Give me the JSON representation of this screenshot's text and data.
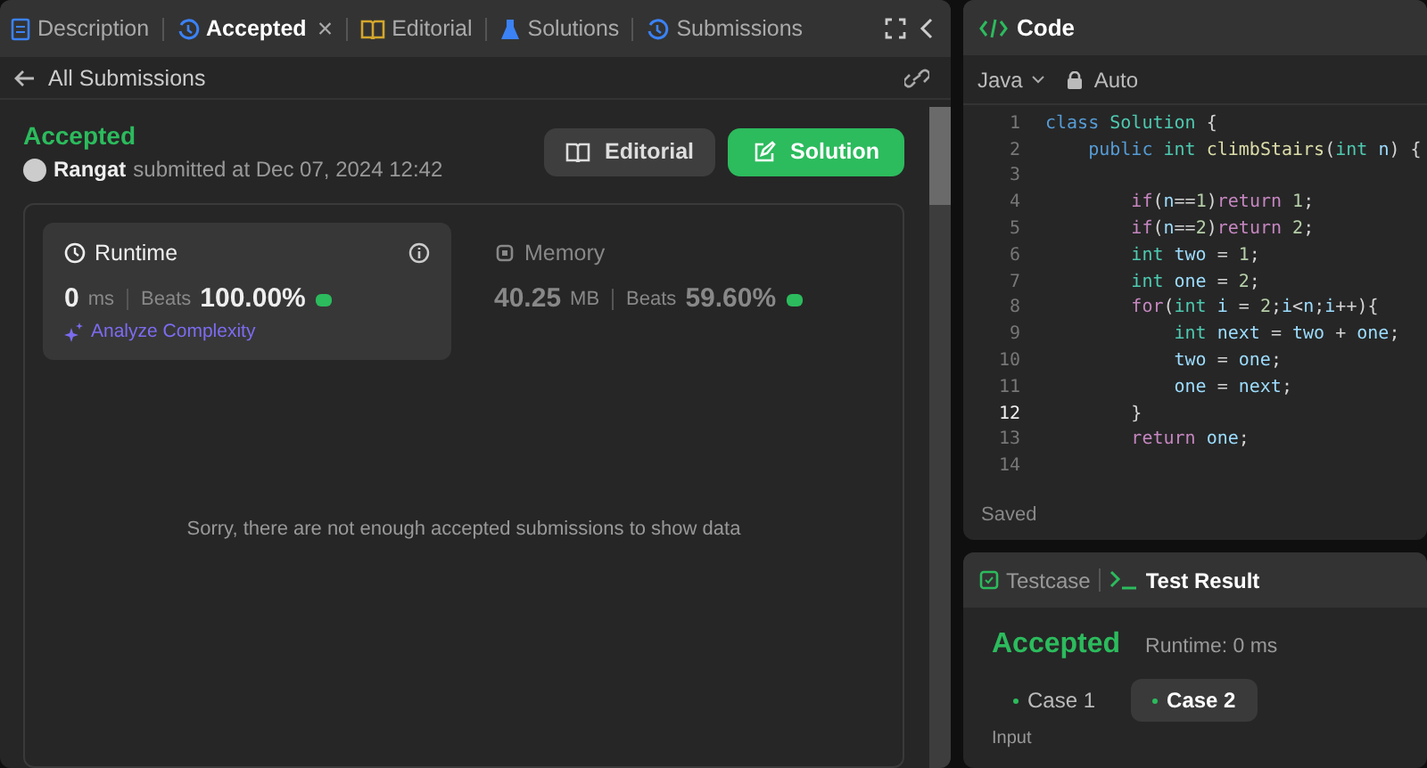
{
  "tabs": [
    {
      "label": "Description",
      "kind": "doc",
      "selected": false,
      "closable": false
    },
    {
      "label": "Accepted",
      "kind": "history",
      "selected": true,
      "closable": true
    },
    {
      "label": "Editorial",
      "kind": "book",
      "selected": false,
      "closable": false
    },
    {
      "label": "Solutions",
      "kind": "flask",
      "selected": false,
      "closable": false
    },
    {
      "label": "Submissions",
      "kind": "history",
      "selected": false,
      "closable": false
    }
  ],
  "close_glyph": "×",
  "back_link": "All Submissions",
  "submission": {
    "status": "Accepted",
    "user": "Rangat",
    "submitted": "submitted at Dec 07, 2024 12:42",
    "buttons": [
      {
        "label": "Editorial",
        "kind": "editorial"
      },
      {
        "label": "Solution",
        "kind": "solution"
      }
    ]
  },
  "stats": [
    {
      "title": "Runtime",
      "kind": "runtime",
      "selected": true,
      "value": "0",
      "unit": "ms",
      "beats_label": "Beats",
      "beats": "100.00%",
      "link": "Analyze Complexity"
    },
    {
      "title": "Memory",
      "kind": "memory",
      "selected": false,
      "value": "40.25",
      "unit": "MB",
      "beats_label": "Beats",
      "beats": "59.60%"
    }
  ],
  "empty_message": "Sorry, there are not enough accepted submissions to show data",
  "code_panel": {
    "title": "Code",
    "language": "Java",
    "mode": "Auto",
    "status": "Saved",
    "lines": [
      {
        "number": "1",
        "current": false,
        "code": "class Solution {"
      },
      {
        "number": "2",
        "current": false,
        "code": "    public int climbStairs(int n) {"
      },
      {
        "number": "3",
        "current": false
      },
      {
        "number": "4",
        "current": false,
        "code": "        if(n==1)return 1;"
      },
      {
        "number": "5",
        "current": false,
        "code": "        if(n==2)return 2;"
      },
      {
        "number": "6",
        "current": false,
        "code": "        int two = 1;"
      },
      {
        "number": "7",
        "current": false,
        "code": "        int one = 2;"
      },
      {
        "number": "8",
        "current": false,
        "code": "        for(int i = 2;i<n;i++){"
      },
      {
        "number": "9",
        "current": false,
        "code": "            int next = two + one;"
      },
      {
        "number": "10",
        "current": false,
        "code": "            two = one;"
      },
      {
        "number": "11",
        "current": false,
        "code": "            one = next;"
      },
      {
        "number": "12",
        "current": true,
        "code": "        }"
      },
      {
        "number": "13",
        "current": false,
        "code": "        return one;"
      },
      {
        "number": "14",
        "current": false
      }
    ]
  },
  "result_panel": {
    "tabs": [
      {
        "label": "Testcase",
        "kind": "check",
        "selected": false
      },
      {
        "label": "Test Result",
        "kind": "terminal",
        "selected": true
      }
    ],
    "status": "Accepted",
    "runtime": "Runtime: 0 ms",
    "cases": [
      {
        "label": "Case 1",
        "selected": false
      },
      {
        "label": "Case 2",
        "selected": true
      }
    ],
    "input_label": "Input"
  }
}
